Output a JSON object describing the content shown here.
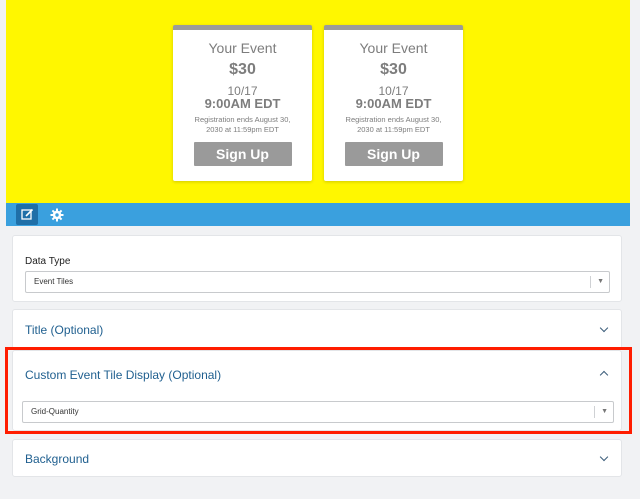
{
  "preview": {
    "tiles": [
      {
        "title": "Your Event",
        "price": "$30",
        "date": "10/17",
        "time": "9:00AM EDT",
        "registration": "Registration ends August 30, 2030 at 11:59pm EDT",
        "button": "Sign Up"
      },
      {
        "title": "Your Event",
        "price": "$30",
        "date": "10/17",
        "time": "9:00AM EDT",
        "registration": "Registration ends August 30, 2030 at 11:59pm EDT",
        "button": "Sign Up"
      }
    ],
    "background_color": "#fff700"
  },
  "toolbar": {
    "edit_icon": "edit-icon",
    "settings_icon": "gear-icon",
    "color": "#3aa0de"
  },
  "panels": {
    "data_type": {
      "label": "Data Type",
      "value": "Event Tiles"
    },
    "title": {
      "label": "Title (Optional)"
    },
    "custom_tile_display": {
      "label": "Custom Event Tile Display (Optional)",
      "value": "Grid-Quantity"
    },
    "background": {
      "label": "Background"
    }
  },
  "highlight_color": "#ff1d00"
}
